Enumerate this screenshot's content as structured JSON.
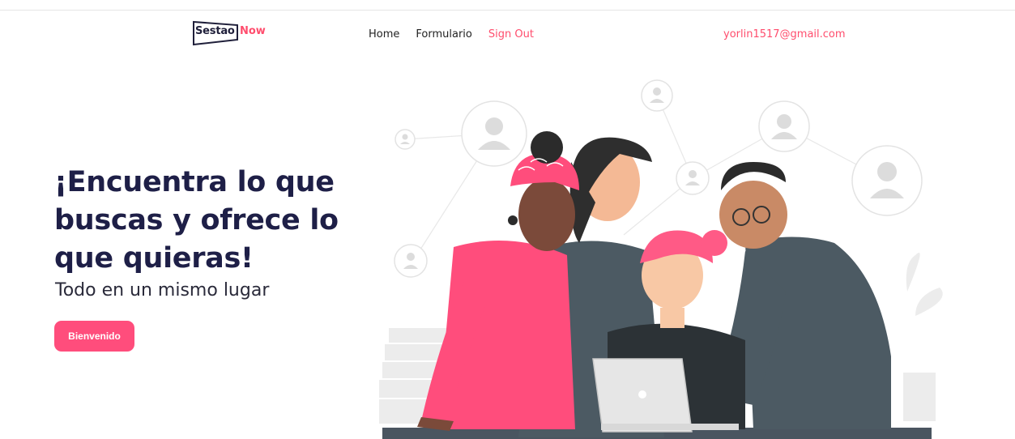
{
  "brand": {
    "part1": "Sestao",
    "part2": "Now"
  },
  "nav": {
    "links": [
      {
        "label": "Home"
      },
      {
        "label": "Formulario"
      },
      {
        "label": "Sign Out"
      }
    ],
    "user_email": "yorlin1517@gmail.com"
  },
  "hero": {
    "title": "¡Encuentra lo que buscas y ofrece lo que quieras!",
    "subtitle": "Todo en un mismo lugar",
    "cta_label": "Bienvenido"
  },
  "colors": {
    "accent": "#ff4d6d",
    "button": "#ff4d7c",
    "title": "#1e1f47"
  },
  "illustration": {
    "icons": [
      "user-icon",
      "laptop-icon",
      "plant-icon"
    ]
  }
}
